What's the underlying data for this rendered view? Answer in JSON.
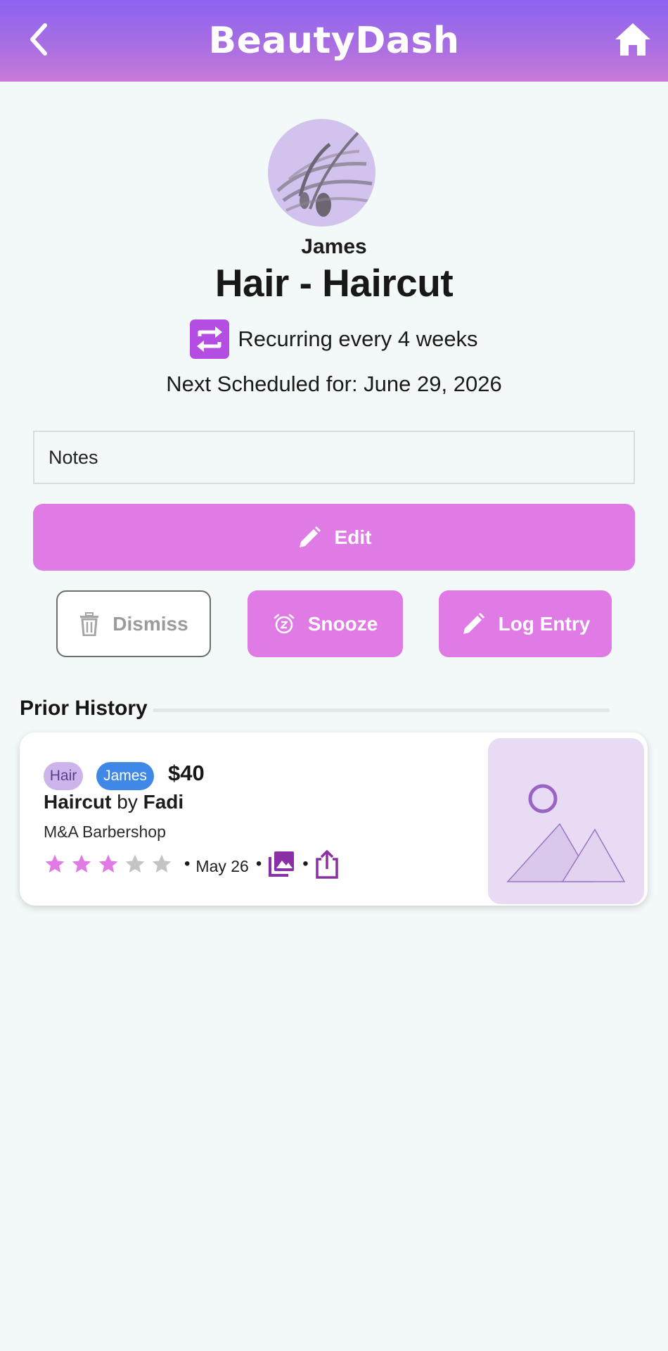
{
  "header": {
    "title": "BeautyDash"
  },
  "client": {
    "name": "James"
  },
  "service": {
    "title": "Hair - Haircut"
  },
  "recurrence": {
    "text": "Recurring every 4 weeks"
  },
  "schedule": {
    "next": "Next Scheduled for: June 29, 2026"
  },
  "notes": {
    "placeholder": "Notes"
  },
  "actions": {
    "edit_label": "Edit",
    "dismiss_label": "Dismiss",
    "snooze_label": "Snooze",
    "log_label": "Log Entry"
  },
  "history": {
    "title": "Prior History",
    "entries": [
      {
        "category": "Hair",
        "person": "James",
        "price": "$40",
        "service": "Haircut",
        "by_word": "by",
        "provider": "Fadi",
        "location": "M&A Barbershop",
        "rating": 3,
        "rating_max": 5,
        "date": "May 26"
      }
    ]
  },
  "colors": {
    "accent": "#e07be6",
    "header_top": "#8c63f2",
    "header_bottom": "#c97ad8",
    "recur_icon": "#b44ee2",
    "chip_blue": "#3f88e8",
    "chip_lavender": "#cdb5eb",
    "star_on": "#e07be6",
    "star_off": "#c4c4c4",
    "icon_purple": "#8a2fa5"
  },
  "icons": {
    "back": "chevron-left-icon",
    "home": "home-icon",
    "recur": "repeat-icon",
    "edit": "pencil-icon",
    "dismiss": "trash-icon",
    "snooze": "alarm-snooze-icon",
    "log": "pencil-icon",
    "gallery": "photos-icon",
    "share": "share-icon"
  }
}
